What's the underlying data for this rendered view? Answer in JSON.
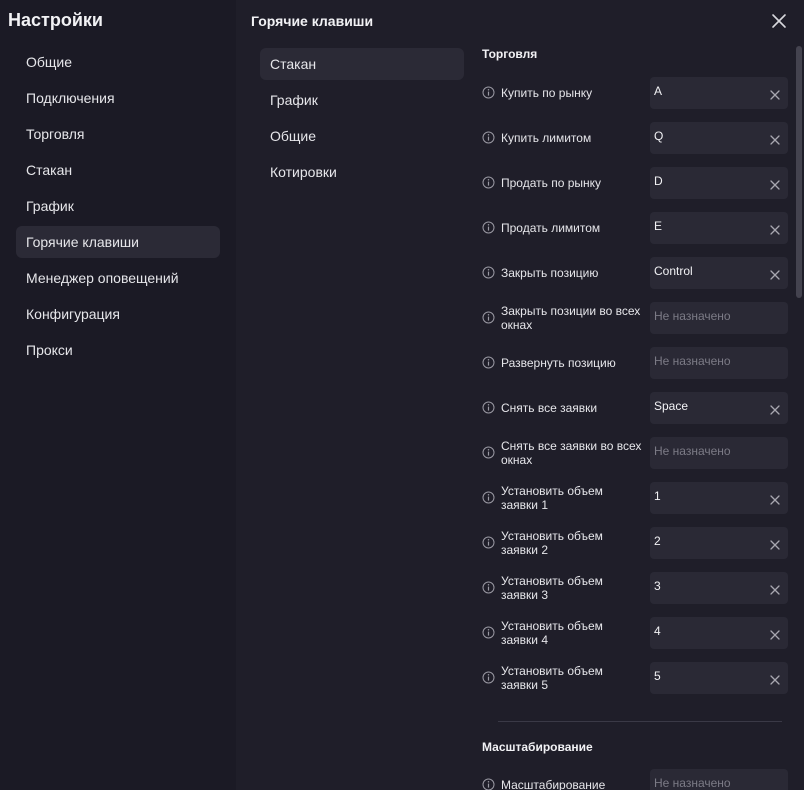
{
  "app": {
    "title": "Настройки"
  },
  "main_nav": {
    "items": [
      {
        "label": "Общие"
      },
      {
        "label": "Подключения"
      },
      {
        "label": "Торговля"
      },
      {
        "label": "Стакан"
      },
      {
        "label": "График"
      },
      {
        "label": "Горячие клавиши",
        "active": true
      },
      {
        "label": "Менеджер оповещений"
      },
      {
        "label": "Конфигурация"
      },
      {
        "label": "Прокси"
      }
    ]
  },
  "section": {
    "title": "Горячие клавиши"
  },
  "sub_nav": {
    "items": [
      {
        "label": "Стакан",
        "active": true
      },
      {
        "label": "График"
      },
      {
        "label": "Общие"
      },
      {
        "label": "Котировки"
      }
    ]
  },
  "icons": {
    "close": "close-icon",
    "info": "info-icon",
    "clear": "clear-icon"
  },
  "colors": {
    "background": "#1b1a25",
    "panel": "#1f1e29",
    "active_item": "#2b2a36",
    "field": "#2a2935",
    "placeholder": "#7c7b86"
  },
  "trading": {
    "title": "Торговля",
    "rows": [
      {
        "label": "Купить по рынку",
        "value": "A"
      },
      {
        "label": "Купить лимитом",
        "value": "Q"
      },
      {
        "label": "Продать по рынку",
        "value": "D"
      },
      {
        "label": "Продать лимитом",
        "value": "E"
      },
      {
        "label": "Закрыть позицию",
        "value": "Control"
      },
      {
        "label": "Закрыть позиции во всех окнах",
        "value": "",
        "placeholder": "Не назначено"
      },
      {
        "label": "Развернуть позицию",
        "value": "",
        "placeholder": "Не назначено"
      },
      {
        "label": "Снять все заявки",
        "value": "Space"
      },
      {
        "label": "Снять все заявки во всех окнах",
        "value": "",
        "placeholder": "Не назначено"
      },
      {
        "label": "Установить объем заявки 1",
        "value": "1"
      },
      {
        "label": "Установить объем заявки 2",
        "value": "2"
      },
      {
        "label": "Установить объем заявки 3",
        "value": "3"
      },
      {
        "label": "Установить объем заявки 4",
        "value": "4"
      },
      {
        "label": "Установить объем заявки 5",
        "value": "5"
      }
    ]
  },
  "scaling": {
    "title": "Масштабирование",
    "rows": [
      {
        "label": "Масштабирование",
        "value": "",
        "placeholder": "Не назначено"
      }
    ]
  }
}
